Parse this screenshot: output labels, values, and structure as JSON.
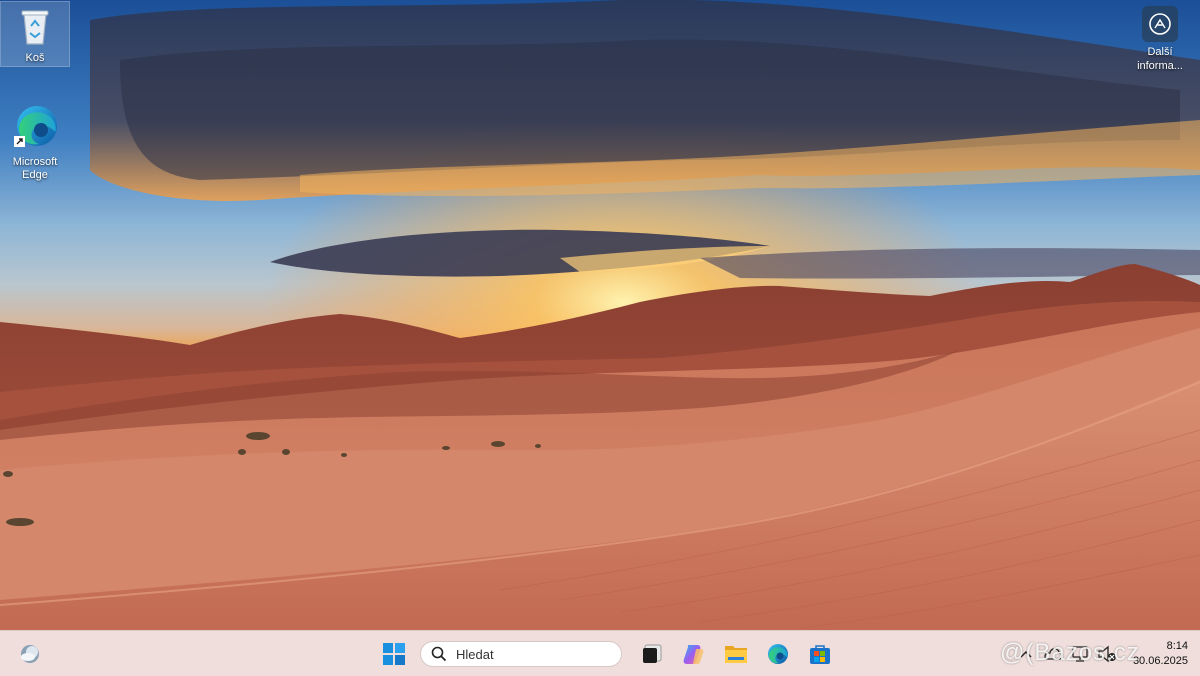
{
  "desktop": {
    "icons": [
      {
        "label": "Koš",
        "icon": "recycle-bin-icon"
      },
      {
        "label": "Microsoft Edge",
        "icon": "edge-icon"
      }
    ],
    "widget": {
      "label_line1": "Další",
      "label_line2": "informa...",
      "icon": "camera-lens-icon"
    }
  },
  "taskbar": {
    "search": {
      "placeholder": "Hledat"
    },
    "pinned": [
      "start-button",
      "search-field",
      "task-view",
      "copilot",
      "file-explorer",
      "edge",
      "microsoft-store"
    ],
    "clock": {
      "time": "8:14",
      "date": "30.06.2025"
    }
  },
  "watermark": "@(Bazos.cz",
  "colors": {
    "taskbar": "#efdedb",
    "sky_top": "#1d5fa8",
    "sand": "#c86a4c"
  }
}
